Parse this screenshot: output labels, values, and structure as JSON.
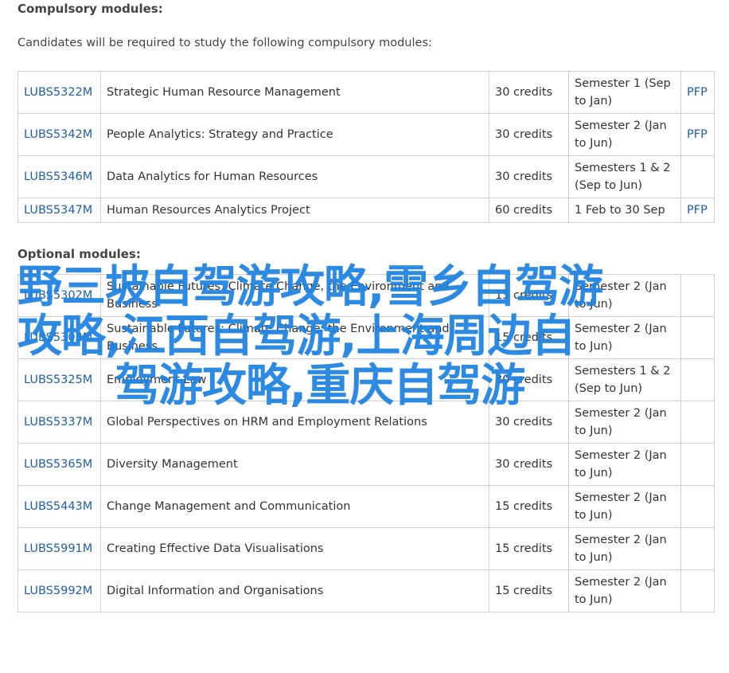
{
  "compulsory": {
    "heading": "Compulsory modules:",
    "intro": "Candidates will be required to study the following compulsory modules:",
    "rows": [
      {
        "code": "LUBS5322M",
        "title": "Strategic Human Resource Management",
        "credits": "30 credits",
        "semester": "Semester 1 (Sep to Jan)",
        "pfp": "PFP"
      },
      {
        "code": "LUBS5342M",
        "title": "People Analytics: Strategy and Practice",
        "credits": "30 credits",
        "semester": "Semester 2 (Jan to Jun)",
        "pfp": "PFP"
      },
      {
        "code": "LUBS5346M",
        "title": "Data Analytics for Human Resources",
        "credits": "30 credits",
        "semester": "Semesters 1 & 2 (Sep to Jun)",
        "pfp": ""
      },
      {
        "code": "LUBS5347M",
        "title": "Human Resources Analytics Project",
        "credits": "60 credits",
        "semester": "1 Feb to 30 Sep",
        "pfp": "PFP"
      }
    ]
  },
  "optional": {
    "heading": "Optional modules:",
    "rows": [
      {
        "code": "LUBS5302M",
        "title": "Sustainable Futures: Climate Change, the Environment and Business",
        "credits": "15 credits",
        "semester": "Semester 2 (Jan to Jun)"
      },
      {
        "code": "LUBS5303M",
        "title": "Sustainable Futures: Climate Change, the Environment and Business",
        "credits": "15 credits",
        "semester": "Semester 2 (Jan to Jun)"
      },
      {
        "code": "LUBS5325M",
        "title": "Employment Law",
        "credits": "30 credits",
        "semester": "Semesters 1 & 2 (Sep to Jun)"
      },
      {
        "code": "LUBS5337M",
        "title": "Global Perspectives on HRM and Employment Relations",
        "credits": "30 credits",
        "semester": "Semester 2 (Jan to Jun)"
      },
      {
        "code": "LUBS5365M",
        "title": "Diversity Management",
        "credits": "30 credits",
        "semester": "Semester 2 (Jan to Jun)"
      },
      {
        "code": "LUBS5443M",
        "title": "Change Management and Communication",
        "credits": "15 credits",
        "semester": "Semester 2 (Jan to Jun)"
      },
      {
        "code": "LUBS5991M",
        "title": "Creating Effective Data Visualisations",
        "credits": "15 credits",
        "semester": "Semester 2 (Jan to Jun)"
      },
      {
        "code": "LUBS5992M",
        "title": "Digital Information and Organisations",
        "credits": "15 credits",
        "semester": "Semester 2 (Jan to Jun)"
      }
    ]
  },
  "watermark": {
    "line1": "野三坡自驾游攻略,雪乡自驾游",
    "line2": "攻略,江西自驾游,上海周边自",
    "line3": "驾游攻略,重庆自驾游"
  },
  "colors": {
    "link": "#1f5fa6",
    "watermark": "#1d82e0",
    "border": "#cfcfcf"
  }
}
